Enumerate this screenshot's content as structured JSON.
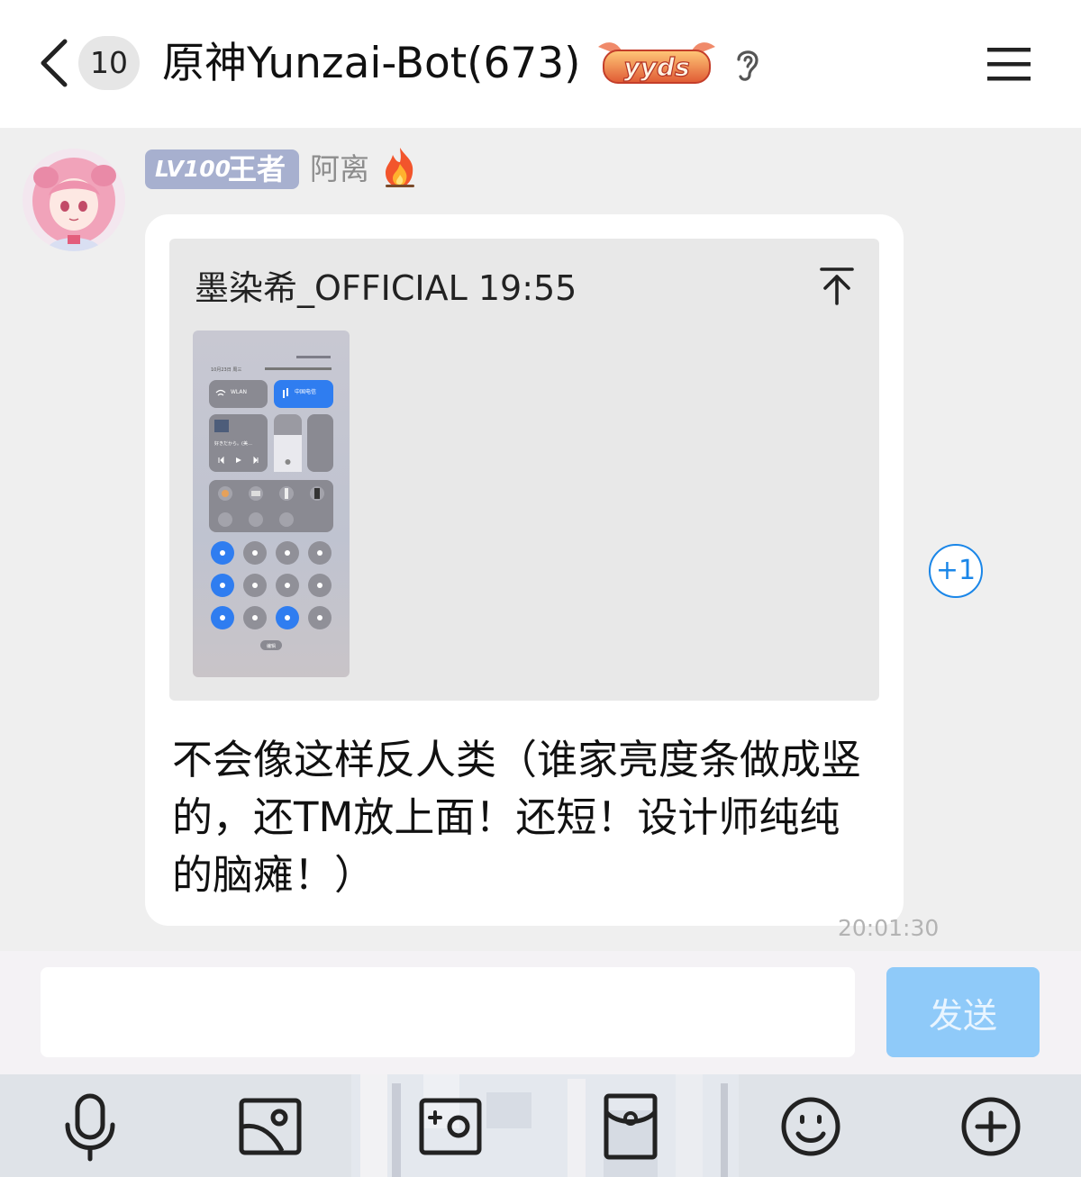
{
  "header": {
    "unread_count": "10",
    "title": "原神Yunzai-Bot(673)",
    "badge_text": "yyds"
  },
  "sender": {
    "level": "LV100",
    "rank": "王者",
    "name": "阿离"
  },
  "message": {
    "quote": {
      "author": "墨染希_OFFICIAL",
      "time": "19:55",
      "image_texts": {
        "wlan": "WLAN",
        "carrier": "中国电信",
        "date": "10月23日 周三",
        "media": "好きだから。(美…",
        "edit": "编辑"
      }
    },
    "text": "不会像这样反人类（谁家亮度条做成竖的，还TM放上面！还短！设计师纯纯的脑瘫！）",
    "timestamp": "20:01:30",
    "reaction": "+1"
  },
  "input": {
    "value": "",
    "send_label": "发送"
  },
  "toolbar": {
    "items": [
      "microphone-icon",
      "image-icon",
      "camera-icon",
      "red-packet-icon",
      "emoji-icon",
      "plus-icon"
    ]
  },
  "colors": {
    "accent": "#1a86e8",
    "send_button": "#8fcaf9",
    "level_badge": "#a7b0cf",
    "background": "#efefef"
  }
}
